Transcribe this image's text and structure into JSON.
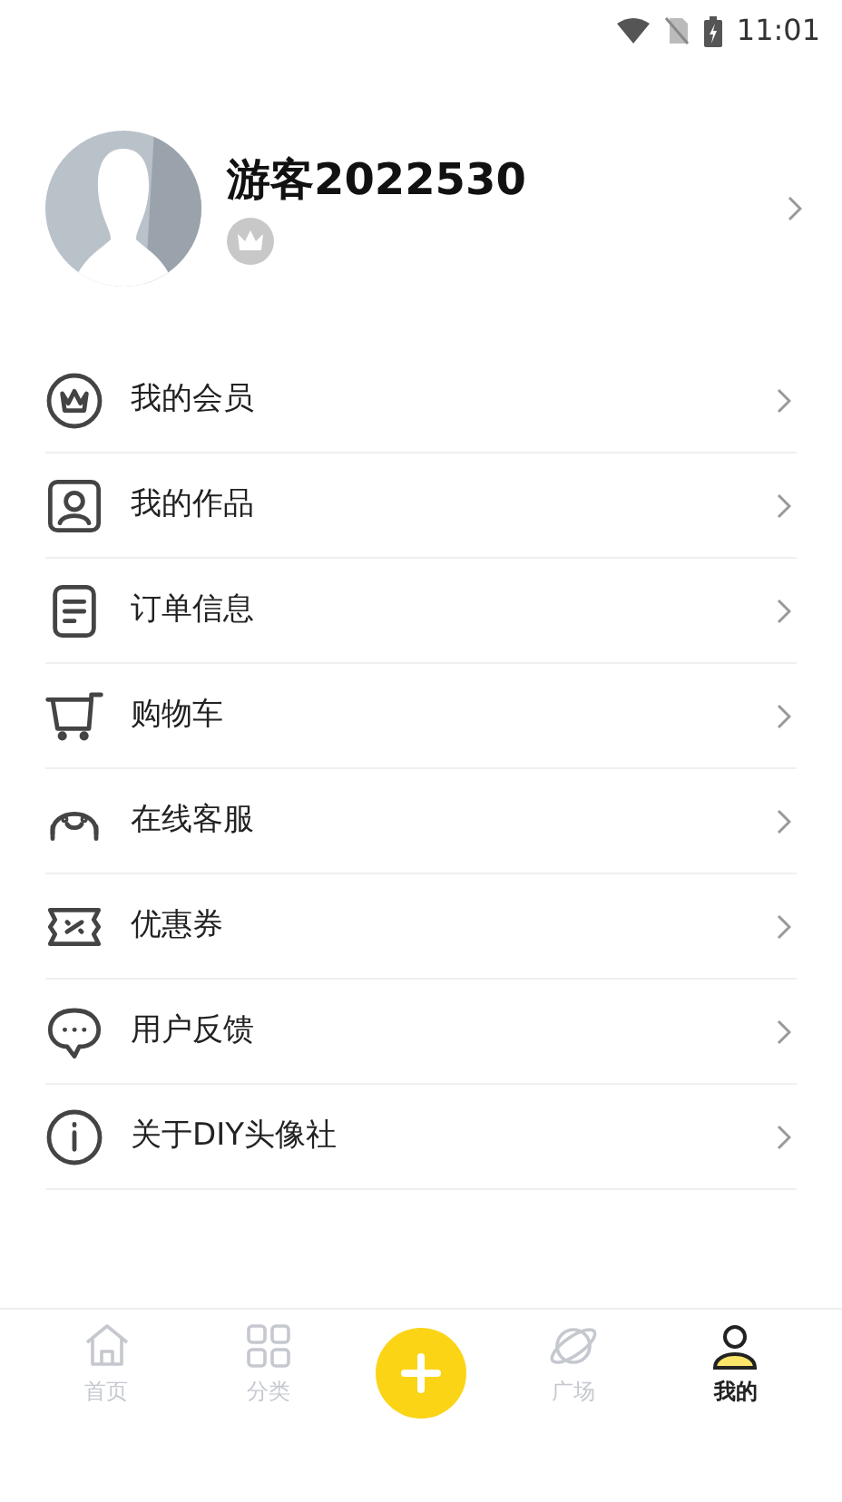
{
  "status_bar": {
    "time": "11:01"
  },
  "profile": {
    "name": "游客2022530"
  },
  "menu": [
    {
      "kind": "vip",
      "label": "我的会员"
    },
    {
      "kind": "works",
      "label": "我的作品"
    },
    {
      "kind": "orders",
      "label": "订单信息"
    },
    {
      "kind": "cart",
      "label": "购物车"
    },
    {
      "kind": "service",
      "label": "在线客服"
    },
    {
      "kind": "coupon",
      "label": "优惠券"
    },
    {
      "kind": "feedback",
      "label": "用户反馈"
    },
    {
      "kind": "about",
      "label": "关于DIY头像社"
    }
  ],
  "tabs": [
    {
      "kind": "home",
      "label": "首页",
      "selected": false
    },
    {
      "kind": "category",
      "label": "分类",
      "selected": false
    },
    {
      "kind": "add"
    },
    {
      "kind": "square",
      "label": "广场",
      "selected": false
    },
    {
      "kind": "mine",
      "label": "我的",
      "selected": true
    }
  ]
}
